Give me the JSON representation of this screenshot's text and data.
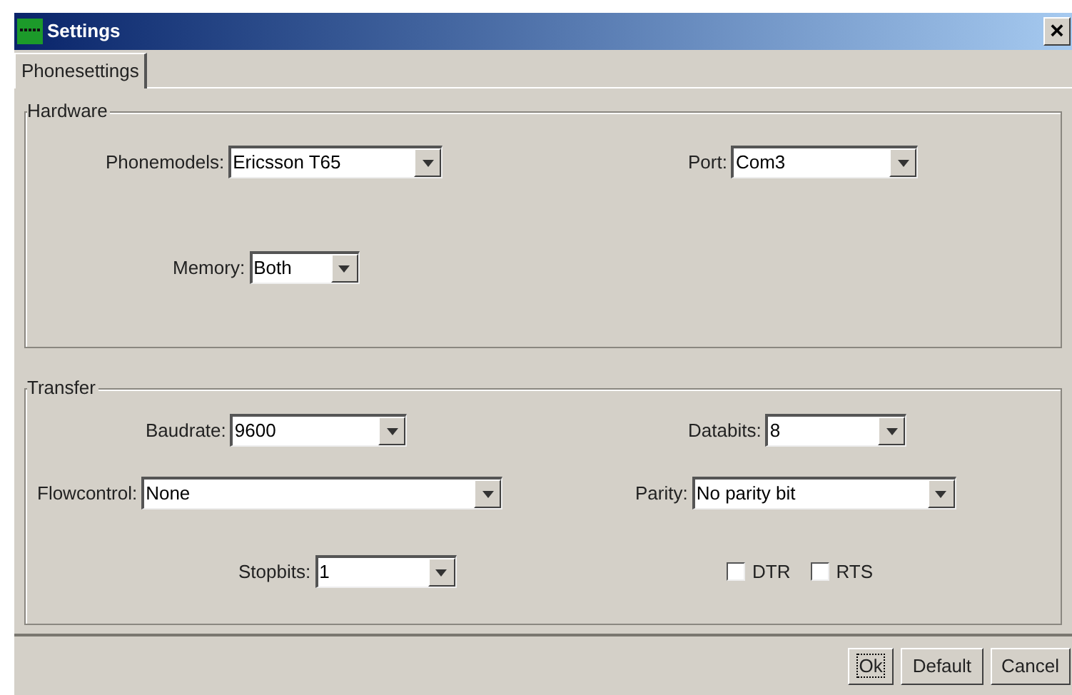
{
  "window": {
    "title": "Settings",
    "close": "×"
  },
  "tabs": [
    {
      "label": "Phonesettings",
      "selected": true
    }
  ],
  "groups": [
    {
      "title": "Hardware",
      "rows": [
        {
          "fields": [
            {
              "kind": "combo",
              "label": "Phonemodels:",
              "value": "Ericsson T65"
            },
            {
              "kind": "combo",
              "label": "Port:",
              "value": "Com3"
            }
          ]
        },
        {
          "fields": [
            {
              "kind": "combo",
              "label": "Memory:",
              "value": "Both"
            }
          ]
        }
      ]
    },
    {
      "title": "Transfer",
      "rows": [
        {
          "fields": [
            {
              "kind": "combo",
              "label": "Baudrate:",
              "value": "9600"
            },
            {
              "kind": "combo",
              "label": "Databits:",
              "value": "8"
            }
          ]
        },
        {
          "fields": [
            {
              "kind": "combo",
              "label": "Flowcontrol:",
              "value": "None"
            },
            {
              "kind": "combo",
              "label": "Parity:",
              "value": "No parity bit"
            }
          ]
        },
        {
          "fields": [
            {
              "kind": "combo",
              "label": "Stopbits:",
              "value": "1"
            },
            {
              "kind": "checkboxes",
              "items": [
                {
                  "label": "DTR",
                  "checked": false
                },
                {
                  "label": "RTS",
                  "checked": false
                }
              ]
            }
          ]
        }
      ]
    }
  ],
  "buttons": [
    {
      "label": "Ok",
      "focused": true
    },
    {
      "label": "Default",
      "focused": false
    },
    {
      "label": "Cancel",
      "focused": false
    }
  ]
}
